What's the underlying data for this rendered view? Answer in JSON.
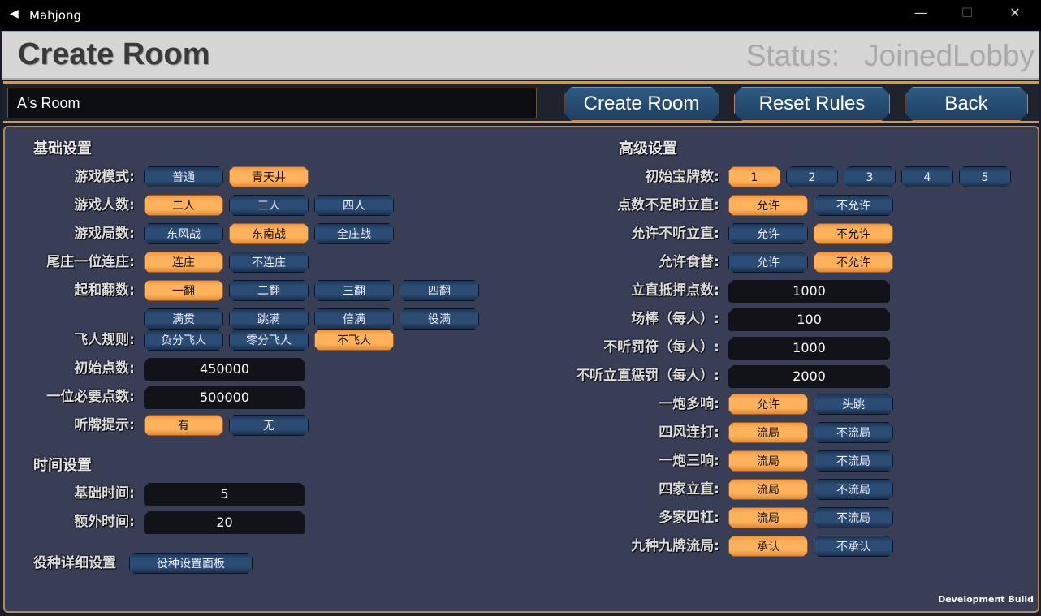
{
  "window": {
    "title": "Mahjong",
    "minimize": "—",
    "maximize": "☐",
    "close": "✕"
  },
  "header": {
    "title": "Create Room",
    "status": "Status: JoinedLobby"
  },
  "toolbar": {
    "room_name": "A's Room",
    "create_label": "Create Room",
    "reset_label": "Reset Rules",
    "back_label": "Back"
  },
  "colors": {
    "selected": "#ffb25c",
    "unselected": "#2b4c74",
    "panel": "#373e56",
    "gold_border": "#c99a5a"
  },
  "basic": {
    "title": "基础设置",
    "rows": [
      {
        "label": "游戏模式:",
        "options": [
          "普通",
          "青天井"
        ],
        "selected": 1
      },
      {
        "label": "游戏人数:",
        "options": [
          "二人",
          "三人",
          "四人"
        ],
        "selected": 0
      },
      {
        "label": "游戏局数:",
        "options": [
          "东风战",
          "东南战",
          "全庄战"
        ],
        "selected": 1
      },
      {
        "label": "尾庄一位连庄:",
        "options": [
          "连庄",
          "不连庄"
        ],
        "selected": 0
      },
      {
        "label": "起和翻数:",
        "options": [
          "一翻",
          "二翻",
          "三翻",
          "四翻",
          "满贯",
          "跳满",
          "倍满",
          "役满"
        ],
        "selected": 0
      },
      {
        "label": "飞人规则:",
        "options": [
          "负分飞人",
          "零分飞人",
          "不飞人"
        ],
        "selected": 2
      },
      {
        "label": "初始点数:",
        "value": "450000"
      },
      {
        "label": "一位必要点数:",
        "value": "500000"
      },
      {
        "label": "听牌提示:",
        "options": [
          "有",
          "无"
        ],
        "selected": 0
      }
    ]
  },
  "time": {
    "title": "时间设置",
    "rows": [
      {
        "label": "基础时间:",
        "value": "5"
      },
      {
        "label": "额外时间:",
        "value": "20"
      }
    ]
  },
  "yaku": {
    "label": "役种详细设置",
    "button": "役种设置面板"
  },
  "advanced": {
    "title": "高级设置",
    "rows": [
      {
        "label": "初始宝牌数:",
        "options": [
          "1",
          "2",
          "3",
          "4",
          "5"
        ],
        "selected": 0,
        "small": true
      },
      {
        "label": "点数不足时立直:",
        "options": [
          "允许",
          "不允许"
        ],
        "selected": 0
      },
      {
        "label": "允许不听立直:",
        "options": [
          "允许",
          "不允许"
        ],
        "selected": 1
      },
      {
        "label": "允许食替:",
        "options": [
          "允许",
          "不允许"
        ],
        "selected": 1
      },
      {
        "label": "立直抵押点数:",
        "value": "1000"
      },
      {
        "label": "场棒（每人）:",
        "value": "100"
      },
      {
        "label": "不听罚符（每人）:",
        "value": "1000"
      },
      {
        "label": "不听立直惩罚（每人）:",
        "value": "2000"
      },
      {
        "label": "一炮多响:",
        "options": [
          "允许",
          "头跳"
        ],
        "selected": 0
      },
      {
        "label": "四风连打:",
        "options": [
          "流局",
          "不流局"
        ],
        "selected": 0
      },
      {
        "label": "一炮三响:",
        "options": [
          "流局",
          "不流局"
        ],
        "selected": 0
      },
      {
        "label": "四家立直:",
        "options": [
          "流局",
          "不流局"
        ],
        "selected": 0
      },
      {
        "label": "多家四杠:",
        "options": [
          "流局",
          "不流局"
        ],
        "selected": 0
      },
      {
        "label": "九种九牌流局:",
        "options": [
          "承认",
          "不承认"
        ],
        "selected": 0
      }
    ]
  },
  "footer": {
    "dev_build": "Development Build"
  }
}
